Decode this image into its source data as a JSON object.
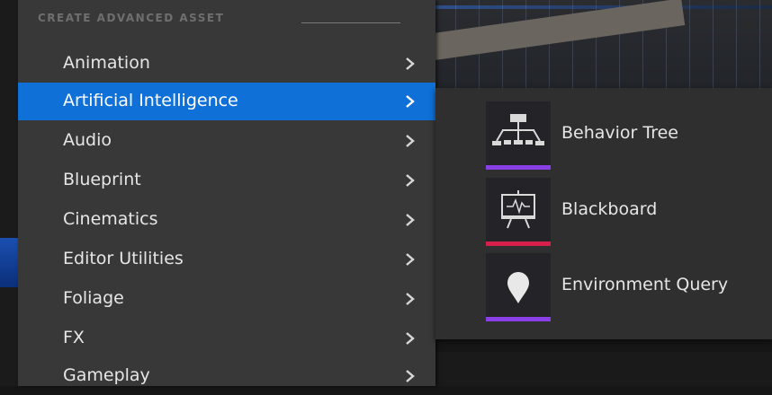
{
  "menu": {
    "section_header": "CREATE ADVANCED ASSET",
    "items": [
      {
        "label": "Animation"
      },
      {
        "label": "Artificial Intelligence"
      },
      {
        "label": "Audio"
      },
      {
        "label": "Blueprint"
      },
      {
        "label": "Cinematics"
      },
      {
        "label": "Editor Utilities"
      },
      {
        "label": "Foliage"
      },
      {
        "label": "FX"
      },
      {
        "label": "Gameplay"
      }
    ],
    "active_item": "Artificial Intelligence",
    "active_color": "#0f70d7"
  },
  "submenu": {
    "items": [
      {
        "label": "Behavior Tree",
        "icon": "behavior-tree-icon",
        "accent": "#8a3fe6"
      },
      {
        "label": "Blackboard",
        "icon": "blackboard-icon",
        "accent": "#d4204a"
      },
      {
        "label": "Environment Query",
        "icon": "map-pin-icon",
        "accent": "#8a3fe6"
      }
    ]
  }
}
